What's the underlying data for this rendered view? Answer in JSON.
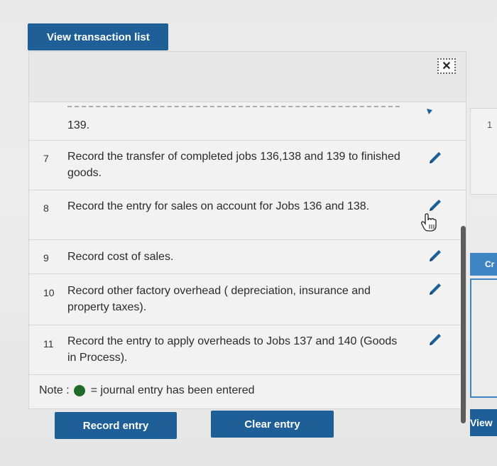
{
  "tab": {
    "label": "View transaction list"
  },
  "close_icon_glyph": "✕",
  "rows": [
    {
      "num": "",
      "desc": "139."
    },
    {
      "num": "7",
      "desc": "Record the transfer of completed jobs 136,138 and 139 to finished goods."
    },
    {
      "num": "8",
      "desc": "Record the entry for sales on account for Jobs 136 and 138."
    },
    {
      "num": "9",
      "desc": "Record cost of sales."
    },
    {
      "num": "10",
      "desc": "Record other factory overhead ( depreciation, insurance and property taxes)."
    },
    {
      "num": "11",
      "desc": "Record the entry to apply overheads to Jobs 137 and 140 (Goods in Process)."
    }
  ],
  "note": {
    "prefix": "Note :",
    "suffix": "= journal entry has been entered"
  },
  "buttons": {
    "record": "Record entry",
    "clear": "Clear entry"
  },
  "right_panel": {
    "number": "1",
    "cr_label": "Cr",
    "view_label": "View"
  },
  "colors": {
    "primary": "#1d5f96",
    "accent": "#3f85c3",
    "entered_dot": "#1f6b2a"
  }
}
